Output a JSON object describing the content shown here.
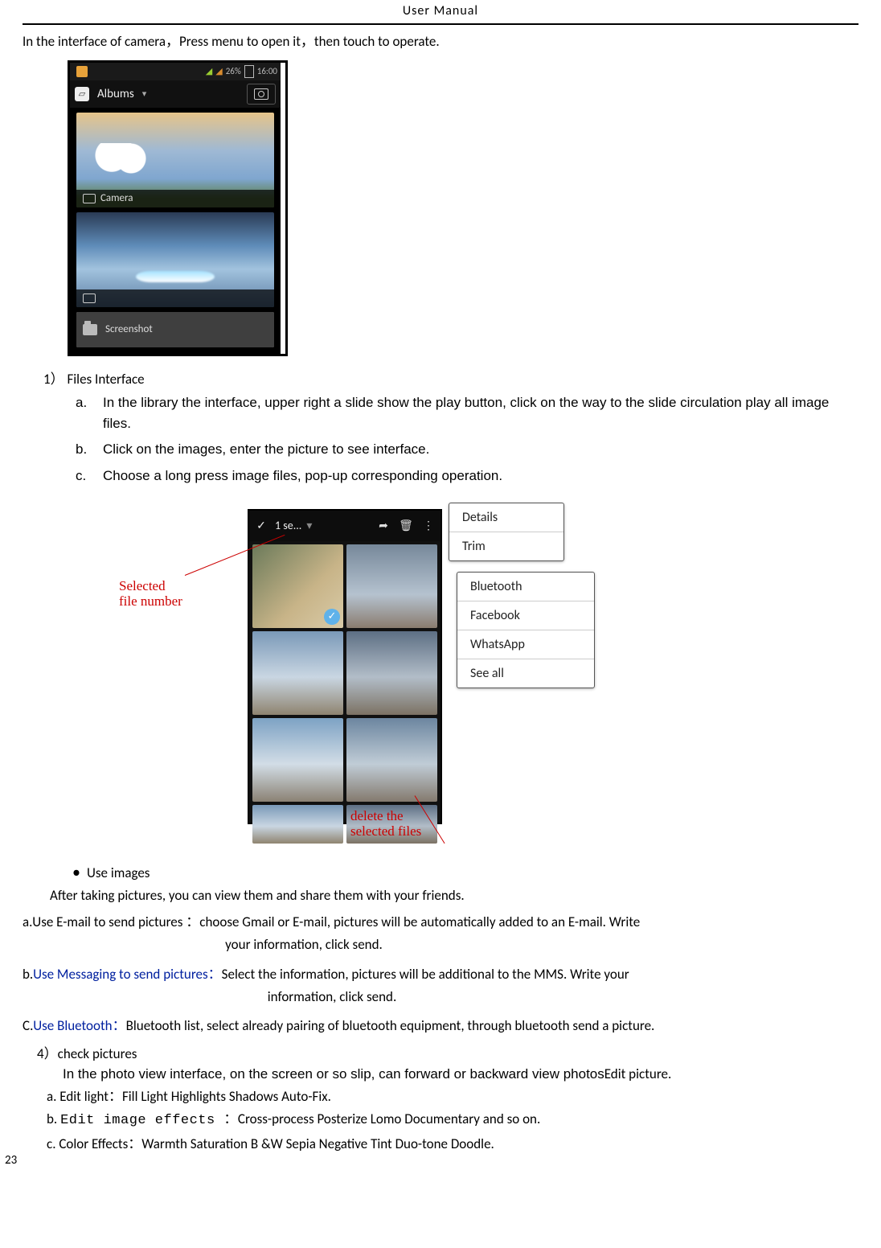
{
  "header": {
    "title": "User    Manual"
  },
  "intro": "In the interface of camera，Press menu to open it，then touch to operate.",
  "shot1": {
    "status": {
      "battery_text": "26%",
      "time": "16:00"
    },
    "titlebar": {
      "label": "Albums"
    },
    "rows": {
      "camera_label": "Camera",
      "screenshot_label": "Screenshot"
    }
  },
  "sec1": {
    "num": "1）",
    "title": "Files Interface",
    "a": "In the library the interface, upper right a slide show the play button, click on the way to the slide circulation play all image files.",
    "b": "Click on the images, enter the picture to see interface.",
    "c": "Choose a long press image files, pop-up corresponding operation."
  },
  "shot2": {
    "selbar": {
      "count": "1 se...",
      "done_glyph": "✓",
      "drop_glyph": "▾",
      "share_glyph": "➦",
      "trash_glyph": "🗑",
      "kebab_glyph": "⋮"
    },
    "anno": {
      "selected": "Selected file number",
      "delete": "delete the selected files"
    },
    "popup1": {
      "r1": "Details",
      "r2": "Trim"
    },
    "popup2": {
      "r1": "Bluetooth",
      "r2": "Facebook",
      "r3": "WhatsApp",
      "r4": "See all"
    }
  },
  "use_images": {
    "bullet": "Use images",
    "after": "After taking pictures, you can view them and share them with your friends."
  },
  "methods": {
    "a_label": "a.",
    "a_head": "Use E-mail to send pictures ：",
    "a_body1": "choose Gmail or E-mail, pictures will be automatically added to an E-mail.  Write",
    "a_body2": "your information, click send.",
    "b_label": "b.",
    "b_head": "Use Messaging to send pictures：",
    "b_body1": "Select the information, pictures will be additional to the MMS. Write your",
    "b_body2": "information, click send.",
    "c_label": "C.",
    "c_head": "Use Bluetooth：",
    "c_body": "Bluetooth list, select already pairing of bluetooth equipment, through bluetooth send a picture."
  },
  "sec4": {
    "num": "4）",
    "title": "check pictures",
    "body": "In the photo view interface, on the screen or so slip, can forward or backward view photos",
    "tail": "Edit picture.",
    "a": "a. Edit light：Fill Light    Highlights    Shadows    Auto-Fix.",
    "b_pre": "b. ",
    "b_mono": "Edit image effects ：",
    "b_post": "Cross-process    Posterize    Lomo    Documentary and so on.",
    "c": "c. Color Effects：Warmth    Saturation B &W    Sepia    Negative    Tint    Duo-tone    Doodle."
  },
  "page_number": "23"
}
